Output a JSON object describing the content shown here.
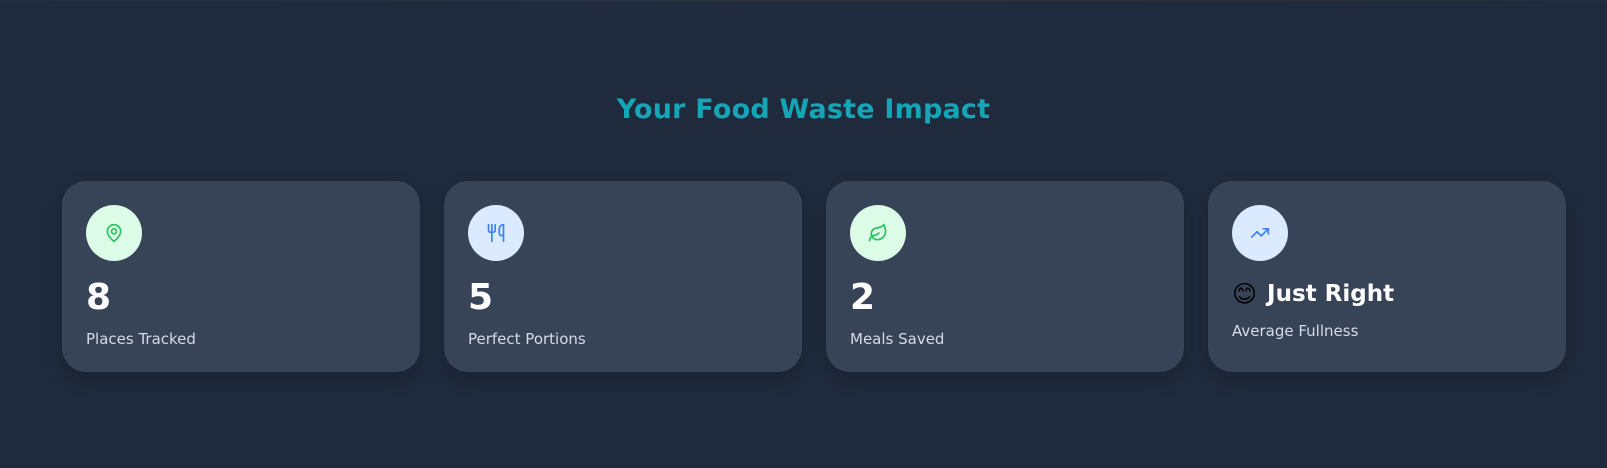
{
  "header": {
    "title": "Your Food Waste Impact"
  },
  "cards": [
    {
      "icon": "map-pin-icon",
      "value": "8",
      "label": "Places Tracked"
    },
    {
      "icon": "utensils-icon",
      "value": "5",
      "label": "Perfect Portions"
    },
    {
      "icon": "leaf-icon",
      "value": "2",
      "label": "Meals Saved"
    },
    {
      "icon": "trending-up-icon",
      "emoji": "😊",
      "value": "Just Right",
      "label": "Average Fullness"
    }
  ],
  "colors": {
    "background": "#1f2a3c",
    "card": "#374357",
    "title": "#14a6b6",
    "green_icon": "#22c55e",
    "blue_icon": "#3b82f6",
    "green_circle": "#dcfce7",
    "blue_circle": "#dbeafe"
  }
}
